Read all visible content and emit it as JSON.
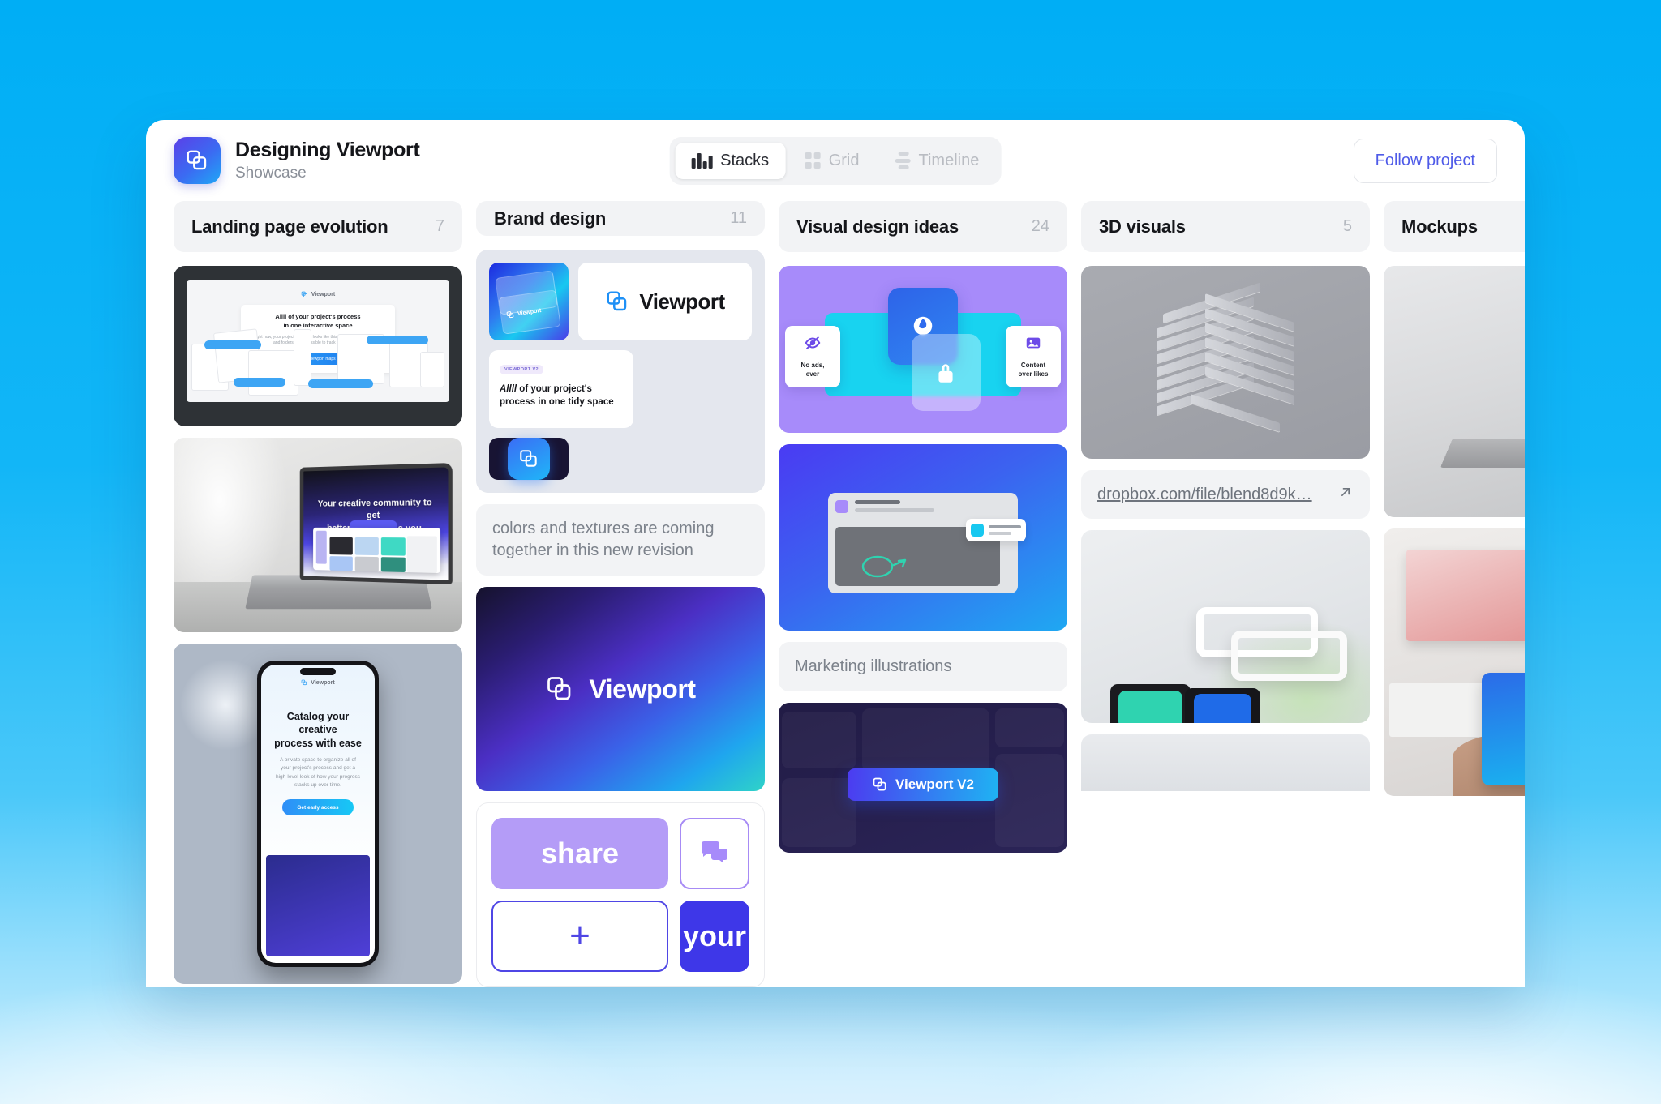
{
  "header": {
    "app_logo_icon": "viewport-squares-logo",
    "title": "Designing Viewport",
    "subtitle": "Showcase",
    "tabs": [
      {
        "label": "Stacks",
        "icon": "stacks-bars-icon",
        "active": true
      },
      {
        "label": "Grid",
        "icon": "grid-squares-icon",
        "active": false
      },
      {
        "label": "Timeline",
        "icon": "timeline-bars-icon",
        "active": false
      }
    ],
    "follow_button": "Follow project"
  },
  "columns": [
    {
      "name": "Landing page evolution",
      "count": "7",
      "cards": [
        {
          "type": "monitor-mockup",
          "logo_label": "Viewport",
          "heading_line1": "Allll of your project's process",
          "heading_line2": "in one interactive space",
          "body": "Right now, your projects process looks like this — scattered across apps and folders. It's impossible to track your progress.",
          "cta": "See Viewport maps"
        },
        {
          "type": "laptop-photo",
          "screen_heading_line1": "Your creative community to get",
          "screen_heading_line2": "better feedback as you design"
        },
        {
          "type": "phone-photo",
          "screen_heading_line1": "Catalog your creative",
          "screen_heading_line2": "process with ease",
          "screen_body": "A private space to organize all of your project's process and get a high-level look of how your progress stacks up over time.",
          "screen_cta": "Get early access"
        }
      ]
    },
    {
      "name": "Brand design",
      "count": "11",
      "cards": [
        {
          "type": "brand-grid",
          "tile_a_label": "Viewport",
          "tile_b_label": "Viewport",
          "tile_c_tag": "VIEWPORT V2",
          "tile_c_emph": "Allll",
          "tile_c_rest": " of your project's process in one tidy space",
          "tile_d_icon": "viewport-squares-logo"
        },
        {
          "type": "note",
          "text": "colors and textures are coming together in this new revision"
        },
        {
          "type": "viewport-gradient",
          "label": "Viewport",
          "icon": "viewport-squares-logo"
        },
        {
          "type": "share-your",
          "share_label": "share",
          "chat_icon": "chat-bubbles-icon",
          "plus_icon": "plus-icon",
          "your_label": "your"
        }
      ]
    },
    {
      "name": "Visual design ideas",
      "count": "24",
      "cards": [
        {
          "type": "feature-cards",
          "left_label_line1": "No ads,",
          "left_label_line2": "ever",
          "left_icon": "eye-off-icon",
          "center_icon": "globe-icon",
          "lock_icon": "lock-icon",
          "right_label_line1": "Content",
          "right_label_line2": "over likes",
          "right_icon": "image-icon"
        },
        {
          "type": "blue-ui"
        },
        {
          "type": "note",
          "text": "Marketing illustrations"
        },
        {
          "type": "dark-grid",
          "badge_label": "Viewport V2",
          "badge_icon": "viewport-squares-logo"
        }
      ]
    },
    {
      "name": "3D visuals",
      "count": "5",
      "cards": [
        {
          "type": "3d-stack"
        },
        {
          "type": "link",
          "url": "dropbox.com/file/blend8d9k…",
          "icon": "external-link-icon"
        },
        {
          "type": "3d-rings"
        },
        {
          "type": "3d-partial"
        }
      ]
    },
    {
      "name": "Mockups",
      "count": "",
      "cards": [
        {
          "type": "laptop-mockup-photo"
        },
        {
          "type": "phone-in-hand-photo"
        }
      ]
    }
  ],
  "colors": {
    "accent_blue": "#00AEF5",
    "brand_indigo": "#4F46E5",
    "purple": "#A78BFA",
    "teal": "#18D3F0",
    "panel_grey": "#F2F3F5"
  }
}
